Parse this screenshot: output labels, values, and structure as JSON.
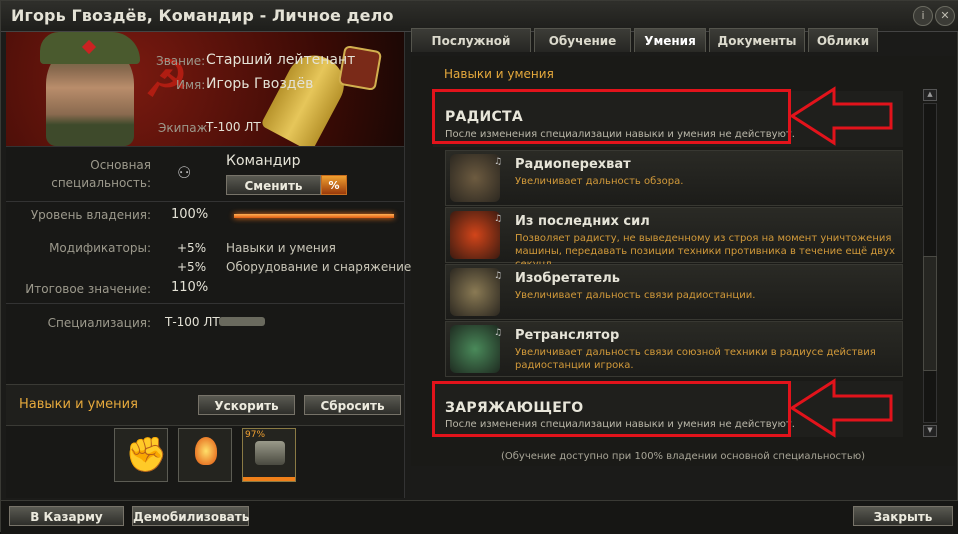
{
  "window": {
    "title": "Игорь Гвоздёв, Командир - Личное дело"
  },
  "profile": {
    "rank_label": "Звание:",
    "rank_value": "Старший лейтенант",
    "name_label": "Имя:",
    "name_value": "Игорь Гвоздёв",
    "crew_label": "Экипаж:",
    "crew_value": "Т-100 ЛТ"
  },
  "specialty": {
    "main_label_1": "Основная",
    "main_label_2": "специальность:",
    "main_value": "Командир",
    "change_button": "Сменить",
    "percent_badge": "%",
    "proficiency_label": "Уровень владения:",
    "proficiency_value": "100%",
    "proficiency_fraction": 1.0,
    "modifiers_label": "Модификаторы:",
    "modifier1_value": "+5%",
    "modifier1_desc": "Навыки и умения",
    "modifier2_value": "+5%",
    "modifier2_desc": "Оборудование и снаряжение",
    "total_label": "Итоговое значение:",
    "total_value": "110%",
    "spec_label": "Специализация:",
    "spec_value": "Т-100 ЛТ"
  },
  "skills_bar": {
    "title": "Навыки и умения",
    "accelerate_button": "Ускорить",
    "reset_button": "Сбросить",
    "progress_percent": "97%",
    "icons": [
      "fist-icon",
      "lightbulb-icon",
      "radio-device-icon"
    ]
  },
  "tabs": [
    "Послужной список",
    "Обучение",
    "Умения",
    "Документы",
    "Облики"
  ],
  "active_tab": "Умения",
  "right": {
    "section_title": "Навыки и умения",
    "group1_title": "РАДИСТА",
    "group1_sub": "После изменения специализации навыки и умения не действуют.",
    "group2_title": "ЗАРЯЖАЮЩЕГО",
    "group2_sub": "После изменения специализации навыки и умения не действуют.",
    "skills": [
      {
        "name": "Радиоперехват",
        "desc": "Увеличивает дальность обзора."
      },
      {
        "name": "Из последних сил",
        "desc": "Позволяет радисту, не выведенному из строя на момент уничтожения машины, передавать позиции техники противника в течение ещё двух секунд."
      },
      {
        "name": "Изобретатель",
        "desc": "Увеличивает дальность связи радиостанции."
      },
      {
        "name": "Ретранслятор",
        "desc": "Увеличивает дальность связи союзной техники в радиусе действия радиостанции игрока."
      }
    ],
    "footer_note": "(Обучение доступно при 100% владении основной специальностью)"
  },
  "bottom": {
    "barracks_button": "В Казарму",
    "demobilize_button": "Демобилизовать",
    "close_button": "Закрыть"
  },
  "colors": {
    "accent": "#e6a93c",
    "annotation_red": "#e2131b"
  }
}
